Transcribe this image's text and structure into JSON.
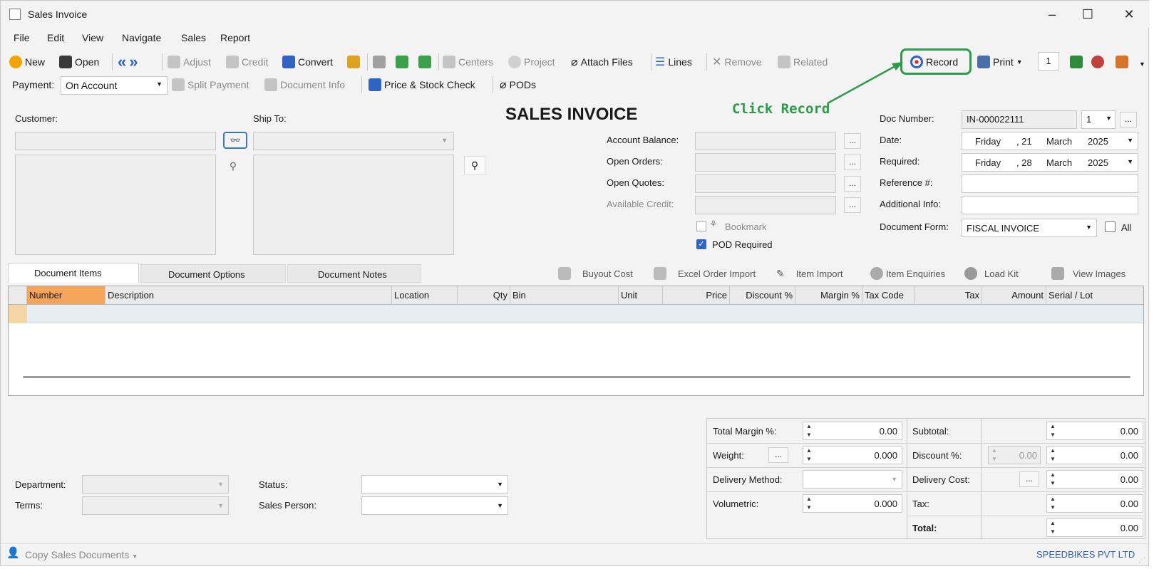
{
  "window": {
    "title": "Sales Invoice",
    "minimize": "–",
    "maximize": "☐",
    "close": "✕"
  },
  "menu": [
    "File",
    "Edit",
    "View",
    "Navigate",
    "Sales",
    "Report"
  ],
  "toolbar1": {
    "new": "New",
    "open": "Open",
    "adjust": "Adjust",
    "credit": "Credit",
    "convert": "Convert",
    "centers": "Centers",
    "project": "Project",
    "attach": "Attach Files",
    "lines": "Lines",
    "remove": "Remove",
    "related": "Related",
    "record": "Record",
    "print": "Print",
    "copies": "1"
  },
  "toolbar2": {
    "payment_label": "Payment:",
    "payment_value": "On Account",
    "split": "Split Payment",
    "docinfo": "Document Info",
    "pricecheck": "Price & Stock Check",
    "pods": "PODs"
  },
  "annotation": {
    "text": "Click Record",
    "color": "#2e9b4a"
  },
  "header": {
    "title": "SALES INVOICE",
    "customer_label": "Customer:",
    "shipto_label": "Ship To:"
  },
  "balances": {
    "account_balance": "Account Balance:",
    "open_orders": "Open Orders:",
    "open_quotes": "Open Quotes:",
    "available_credit": "Available Credit:",
    "bookmark": "Bookmark",
    "pod_required": "POD Required",
    "dots": "..."
  },
  "docinfo": {
    "doc_number_label": "Doc Number:",
    "doc_number": "IN-000022111",
    "doc_copy": "1",
    "date_label": "Date:",
    "date_day": "Friday",
    "date_num": ", 21",
    "date_month": "March",
    "date_year": "2025",
    "required_label": "Required:",
    "req_day": "Friday",
    "req_num": ", 28",
    "req_month": "March",
    "req_year": "2025",
    "reference_label": "Reference #:",
    "additional_label": "Additional Info:",
    "form_label": "Document Form:",
    "form_value": "FISCAL INVOICE",
    "all_label": "All"
  },
  "tabs": [
    "Document Items",
    "Document Options",
    "Document Notes"
  ],
  "item_actions": [
    "Buyout Cost",
    "Excel Order Import",
    "Item Import",
    "Item Enquiries",
    "Load Kit",
    "View Images"
  ],
  "columns": [
    "Number",
    "Description",
    "Location",
    "Qty",
    "Bin",
    "Unit",
    "Price",
    "Discount %",
    "Margin %",
    "Tax Code",
    "Tax",
    "Amount",
    "Serial / Lot"
  ],
  "footer_left": {
    "department": "Department:",
    "terms": "Terms:",
    "status": "Status:",
    "sales_person": "Sales Person:"
  },
  "summary": {
    "total_margin": "Total Margin %:",
    "total_margin_val": "0.00",
    "weight": "Weight:",
    "weight_val": "0.000",
    "delivery_method": "Delivery Method:",
    "volumetric": "Volumetric:",
    "volumetric_val": "0.000",
    "subtotal": "Subtotal:",
    "subtotal_val": "0.00",
    "discount": "Discount %:",
    "discount_pct": "0.00",
    "discount_val": "0.00",
    "delivery_cost": "Delivery Cost:",
    "delivery_cost_val": "0.00",
    "tax": "Tax:",
    "tax_val": "0.00",
    "total": "Total:",
    "total_val": "0.00"
  },
  "status": {
    "copy": "Copy Sales Documents",
    "company": "SPEEDBIKES PVT LTD"
  }
}
